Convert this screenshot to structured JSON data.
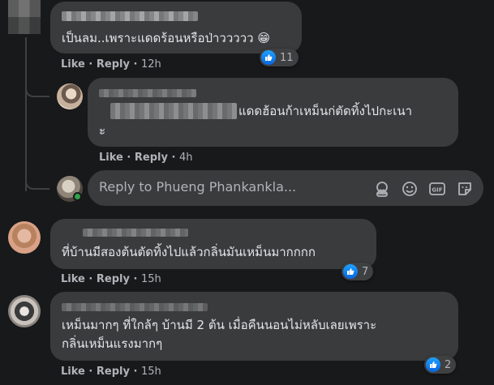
{
  "comment1": {
    "text": "เป็นลม..เพราะแดดร้อนหรือป่าววววว",
    "emoji": "😁",
    "like_label": "Like",
    "sep": "·",
    "reply_label": "Reply",
    "time": "12h",
    "reaction_count": "11"
  },
  "reply1": {
    "text": "แดดฮ้อนก้าเหม็นก่ตัดทิ้งไปกะเนา",
    "text_line2": "ะ",
    "like_label": "Like",
    "sep": "·",
    "reply_label": "Reply",
    "time": "4h"
  },
  "reply_input": {
    "placeholder": "Reply to Phueng Phankankla..."
  },
  "comment2": {
    "text": "ที่บ้านมีสองต้นตัดทิ้งไปแล้วกลิ่นมันเหม็นมากกกก",
    "like_label": "Like",
    "sep": "·",
    "reply_label": "Reply",
    "time": "15h",
    "reaction_count": "7"
  },
  "comment3": {
    "text_line1": "เหม็นมากๆ ที่ใกล้ๆ บ้านมี 2 ต้น เมื่อคืนนอนไม่หลับเลยเพราะ",
    "text_line2": "กลิ่นเหม็นแรงมากๆ",
    "like_label": "Like",
    "sep": "·",
    "reply_label": "Reply",
    "time": "15h",
    "reaction_count": "2"
  },
  "colors": {
    "background": "#18191a",
    "bubble": "#3a3b3c",
    "text": "#e4e6eb",
    "meta": "#b0b3b8",
    "like_blue": "#1877f2",
    "online_green": "#31a24c"
  }
}
